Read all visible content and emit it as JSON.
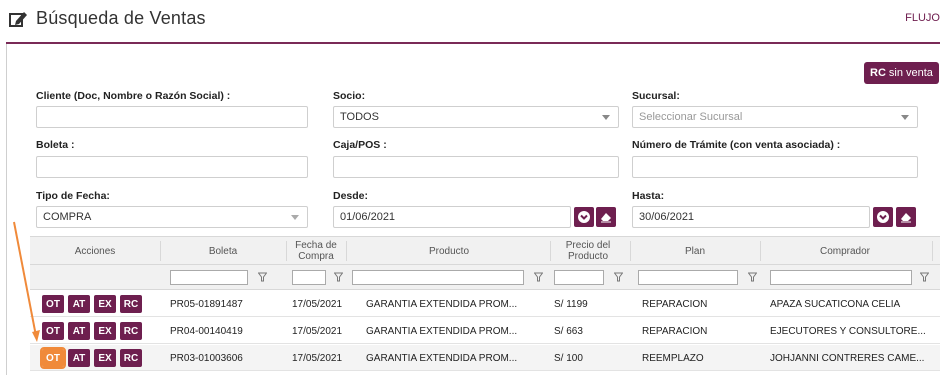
{
  "header": {
    "title": "Búsqueda de Ventas",
    "right_link": "FLUJO"
  },
  "rc_button": {
    "prefix": "RC",
    "label": "sin venta"
  },
  "filters": {
    "cliente": {
      "label": "Cliente (Doc, Nombre o Razón Social) :",
      "value": ""
    },
    "socio": {
      "label": "Socio:",
      "value": "TODOS"
    },
    "sucursal": {
      "label": "Sucursal:",
      "placeholder": "Seleccionar Sucursal"
    },
    "boleta": {
      "label": "Boleta :",
      "value": ""
    },
    "caja": {
      "label": "Caja/POS :",
      "value": ""
    },
    "tramite": {
      "label": "Número de Trámite (con venta asociada) :",
      "value": ""
    },
    "tipo_fecha": {
      "label": "Tipo de Fecha:",
      "value": "COMPRA"
    },
    "desde": {
      "label": "Desde:",
      "value": "01/06/2021"
    },
    "hasta": {
      "label": "Hasta:",
      "value": "30/06/2021"
    }
  },
  "grid": {
    "columns": [
      "Acciones",
      "Boleta",
      "Fecha de Compra",
      "Producto",
      "Precio del Producto",
      "Plan",
      "Comprador"
    ],
    "action_labels": [
      "OT",
      "AT",
      "EX",
      "RC"
    ],
    "rows": [
      {
        "boleta": "PR05-01891487",
        "fecha": "17/05/2021",
        "producto": "GARANTIA EXTENDIDA PROM...",
        "precio": "S/ 1199",
        "plan": "REPARACION",
        "comprador": "APAZA SUCATICONA CELIA"
      },
      {
        "boleta": "PR04-00140419",
        "fecha": "17/05/2021",
        "producto": "GARANTIA EXTENDIDA PROM...",
        "precio": "S/ 663",
        "plan": "REPARACION",
        "comprador": "EJECUTORES Y CONSULTORE..."
      },
      {
        "boleta": "PR03-01003606",
        "fecha": "17/05/2021",
        "producto": "GARANTIA EXTENDIDA PROM...",
        "precio": "S/ 100",
        "plan": "REEMPLAZO",
        "comprador": "JOHJANNI CONTRERES CAME..."
      }
    ]
  },
  "colors": {
    "brand": "#6e1f4f",
    "highlight": "#f08a3a"
  }
}
